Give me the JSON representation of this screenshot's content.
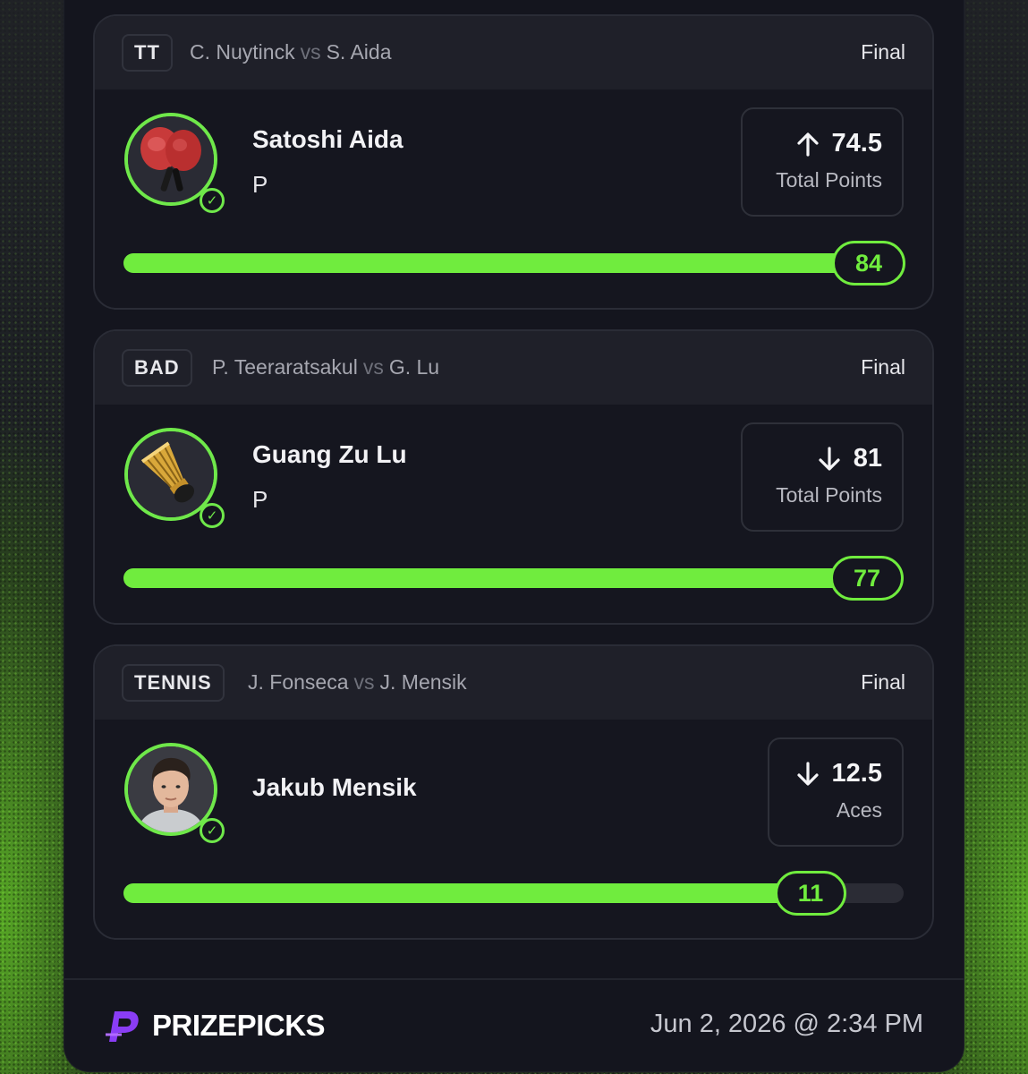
{
  "cards": [
    {
      "sport": "TT",
      "player_a": "C. Nuytinck",
      "vs": "vs",
      "player_b": "S. Aida",
      "status": "Final",
      "name": "Satoshi Aida",
      "position": "P",
      "avatar_icon": "ping-pong-paddles-icon",
      "direction": "up",
      "line": "74.5",
      "stat": "Total Points",
      "result": "84",
      "progress_fraction": 1.0
    },
    {
      "sport": "BAD",
      "player_a": "P. Teeraratsakul",
      "vs": "vs",
      "player_b": "G. Lu",
      "status": "Final",
      "name": "Guang Zu Lu",
      "position": "P",
      "avatar_icon": "shuttlecock-icon",
      "direction": "down",
      "line": "81",
      "stat": "Total Points",
      "result": "77",
      "progress_fraction": 0.95
    },
    {
      "sport": "TENNIS",
      "player_a": "J. Fonseca",
      "vs": "vs",
      "player_b": "J. Mensik",
      "status": "Final",
      "name": "Jakub Mensik",
      "position": "",
      "avatar_icon": "player-photo",
      "direction": "down",
      "line": "12.5",
      "stat": "Aces",
      "result": "11",
      "progress_fraction": 0.88
    }
  ],
  "footer": {
    "brand": "PRIZEPICKS",
    "date": "Jun 2, 2026 @ 2:34 PM"
  },
  "colors": {
    "accent_green": "#70ec3e",
    "panel_bg": "#14151e",
    "header_bg": "#1f2029",
    "brand_purple": "#8a3df5"
  }
}
